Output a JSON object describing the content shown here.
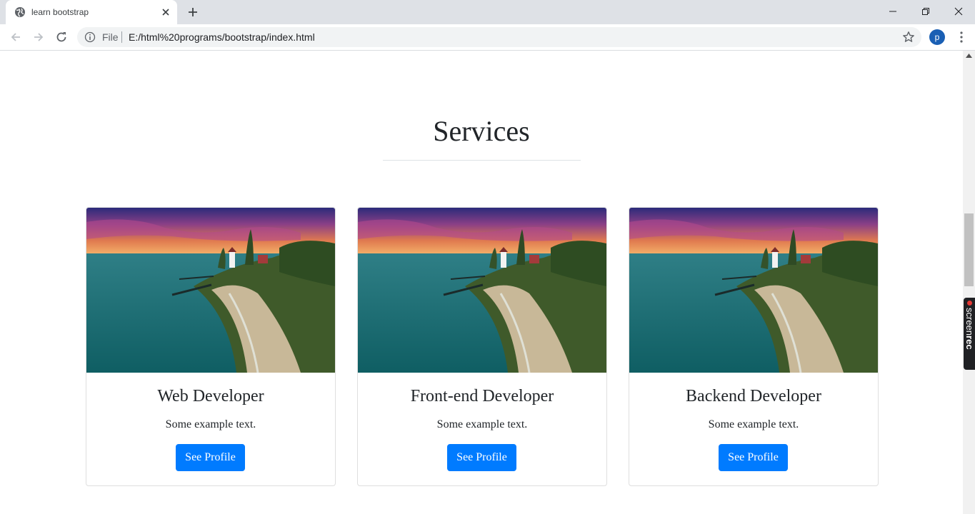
{
  "browser": {
    "tab_title": "learn bootstrap",
    "url_scheme_label": "File",
    "url": "E:/html%20programs/bootstrap/index.html",
    "profile_initial": "p",
    "icons": [
      "globe-icon",
      "close-icon",
      "plus-icon",
      "minimize-icon",
      "restore-icon",
      "close-window-icon",
      "back-icon",
      "forward-icon",
      "reload-icon",
      "info-icon",
      "star-icon",
      "kebab-menu-icon"
    ]
  },
  "recorder_badge": {
    "text_light": "screen",
    "text_bold": "rec"
  },
  "section": {
    "title": "Services"
  },
  "cards": [
    {
      "title": "Web Developer",
      "text": "Some example text.",
      "button": "See Profile"
    },
    {
      "title": "Front-end Developer",
      "text": "Some example text.",
      "button": "See Profile"
    },
    {
      "title": "Backend Developer",
      "text": "Some example text.",
      "button": "See Profile"
    }
  ],
  "colors": {
    "primary": "#007bff",
    "text": "#212529",
    "chrome": "#dee1e6",
    "avatar": "#1a5fb4"
  }
}
